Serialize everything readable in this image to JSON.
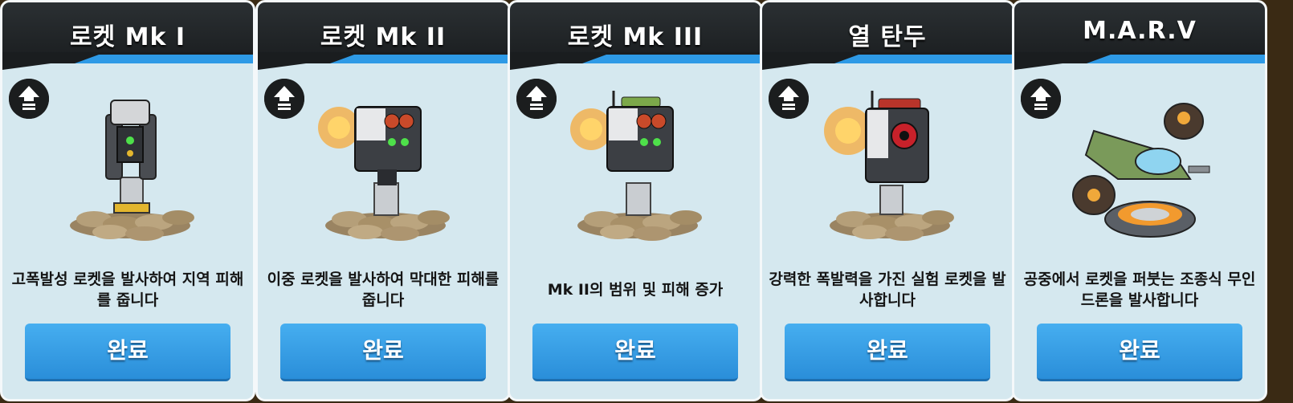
{
  "cards": [
    {
      "title": "로켓 Mk I",
      "description": "고폭발성 로켓을 발사하여 지역 피해를 줍니다",
      "button_label": "완료",
      "icon": "upgrade-arrow-icon",
      "art": "rocket-mk1-turret"
    },
    {
      "title": "로켓 Mk II",
      "description": "이중 로켓을 발사하여 막대한 피해를 줍니다",
      "button_label": "완료",
      "icon": "upgrade-arrow-icon",
      "art": "rocket-mk2-turret"
    },
    {
      "title": "로켓 Mk III",
      "description": "Mk II의 범위 및 피해 증가",
      "button_label": "완료",
      "icon": "upgrade-arrow-icon",
      "art": "rocket-mk3-turret"
    },
    {
      "title": "열 탄두",
      "description": "강력한 폭발력을 가진 실험 로켓을 발사합니다",
      "button_label": "완료",
      "icon": "upgrade-arrow-icon",
      "art": "heat-warhead-turret"
    },
    {
      "title": "M.A.R.V",
      "description": "공중에서 로켓을 퍼붓는 조종식 무인 드론을 발사합니다",
      "button_label": "완료",
      "icon": "upgrade-arrow-icon",
      "art": "marv-drone"
    }
  ],
  "colors": {
    "accent": "#2e9ae6",
    "header": "#1f2426",
    "card_bg": "#d5e8ef",
    "button": "#3aa3ea"
  }
}
